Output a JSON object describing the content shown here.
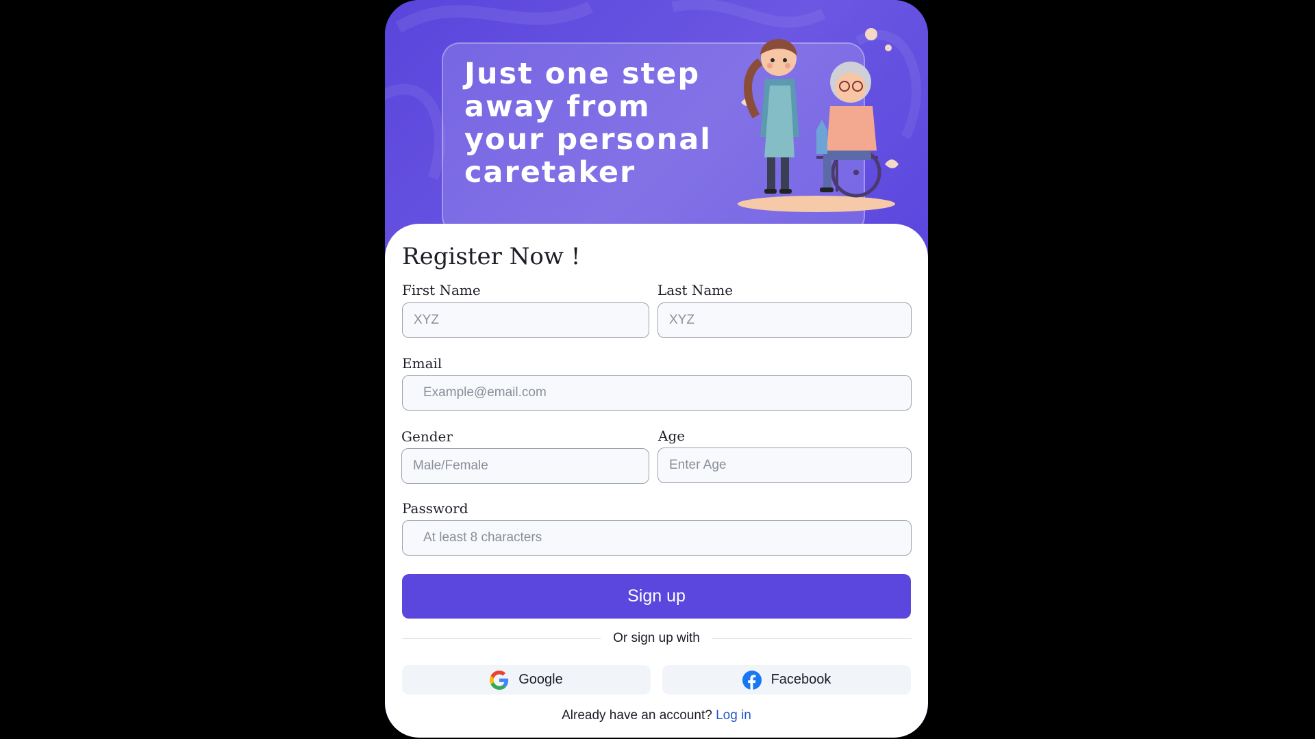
{
  "hero": {
    "title": "Just one step away from your personal caretaker"
  },
  "form": {
    "title": "Register Now !",
    "first_name": {
      "label": "First Name",
      "placeholder": "XYZ"
    },
    "last_name": {
      "label": "Last Name",
      "placeholder": "XYZ"
    },
    "email": {
      "label": "Email",
      "placeholder": "Example@email.com"
    },
    "gender": {
      "label": "Gender",
      "placeholder": "Male/Female"
    },
    "age": {
      "label": "Age",
      "placeholder": "Enter Age"
    },
    "password": {
      "label": "Password",
      "placeholder": "At least 8 characters"
    },
    "signup_label": "Sign up",
    "divider_text": "Or sign up with",
    "google_label": "Google",
    "facebook_label": "Facebook",
    "login_prompt": "Already have an account?",
    "login_link": "Log in"
  },
  "colors": {
    "primary": "#5b47de",
    "link": "#2357c9",
    "field_bg": "#f7f9fc",
    "social_bg": "#f1f4f8"
  },
  "icons": {
    "google": "google-logo-icon",
    "facebook": "facebook-logo-icon",
    "illustration": "caretaker-with-elderly-woman-in-wheelchair"
  }
}
